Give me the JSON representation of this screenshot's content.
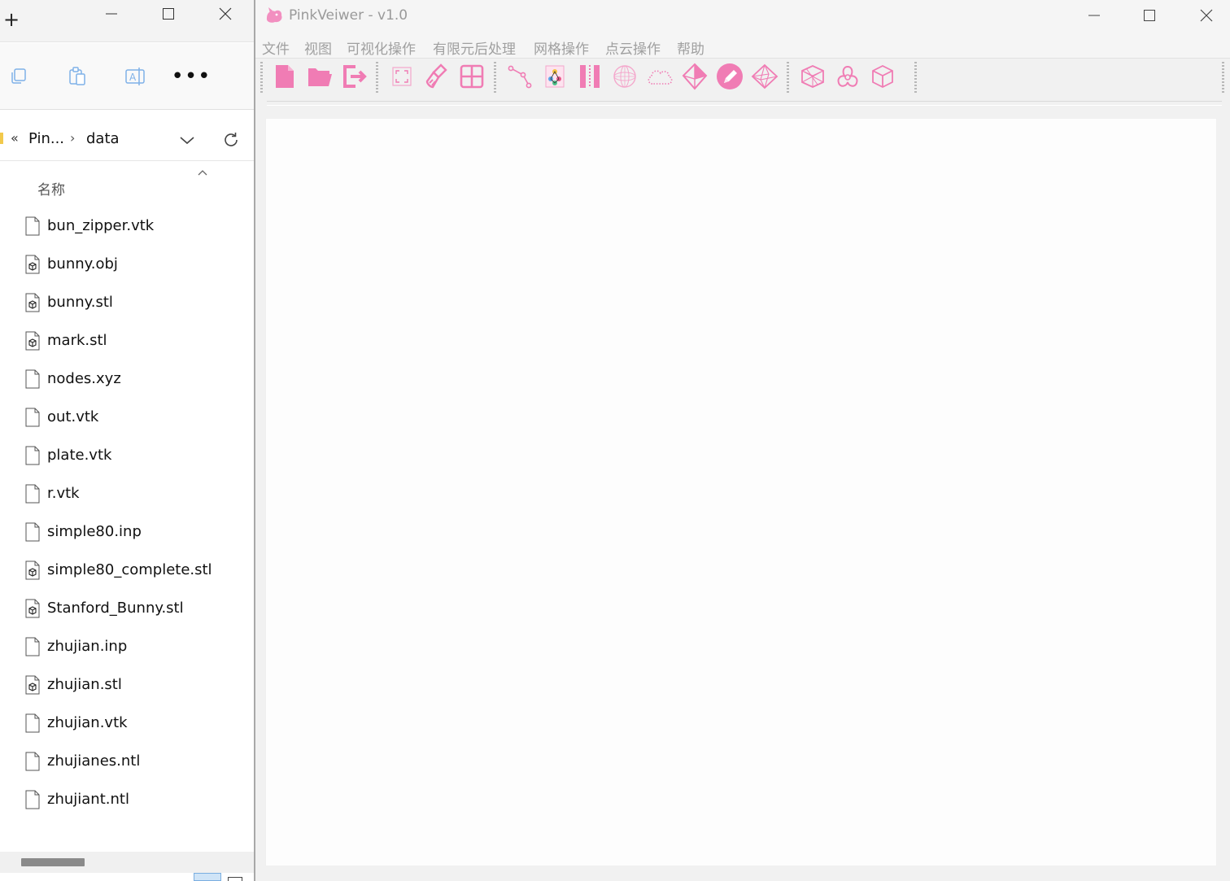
{
  "explorer": {
    "new_tab_glyph": "+",
    "toolbar": {
      "icons": [
        "copy-icon",
        "paste-icon",
        "rename-icon"
      ],
      "more_label": "•••"
    },
    "address": {
      "overflow": "«",
      "crumbs": [
        "Pin...",
        "data"
      ],
      "separator": "›"
    },
    "column_header": "名称",
    "files": [
      {
        "name": "bun_zipper.vtk",
        "type": "generic"
      },
      {
        "name": "bunny.obj",
        "type": "model"
      },
      {
        "name": "bunny.stl",
        "type": "model"
      },
      {
        "name": "mark.stl",
        "type": "model"
      },
      {
        "name": "nodes.xyz",
        "type": "generic"
      },
      {
        "name": "out.vtk",
        "type": "generic"
      },
      {
        "name": "plate.vtk",
        "type": "generic"
      },
      {
        "name": "r.vtk",
        "type": "generic"
      },
      {
        "name": "simple80.inp",
        "type": "generic"
      },
      {
        "name": "simple80_complete.stl",
        "type": "model"
      },
      {
        "name": "Stanford_Bunny.stl",
        "type": "model"
      },
      {
        "name": "zhujian.inp",
        "type": "generic"
      },
      {
        "name": "zhujian.stl",
        "type": "model"
      },
      {
        "name": "zhujian.vtk",
        "type": "generic"
      },
      {
        "name": "zhujianes.ntl",
        "type": "generic"
      },
      {
        "name": "zhujiant.ntl",
        "type": "generic"
      }
    ]
  },
  "pinkveiwer": {
    "title": "PinkVeiwer - v1.0",
    "menus": [
      "文件",
      "视图",
      "可视化操作",
      "有限元后处理",
      "网格操作",
      "点云操作",
      "帮助"
    ],
    "toolbar": [
      "new-file-icon",
      "open-folder-icon",
      "exit-icon",
      "fit-view-icon",
      "clear-brush-icon",
      "grid-view-icon",
      "curve-path-icon",
      "color-map-icon",
      "section-bars-icon",
      "sphere-mesh-icon",
      "point-cloud-icon",
      "gem-icon",
      "pen-edit-icon",
      "octahedron-icon",
      "wireframe-cube-icon",
      "surface-knot-icon",
      "solid-cube-icon"
    ],
    "accent_color": "#f07cb4"
  }
}
